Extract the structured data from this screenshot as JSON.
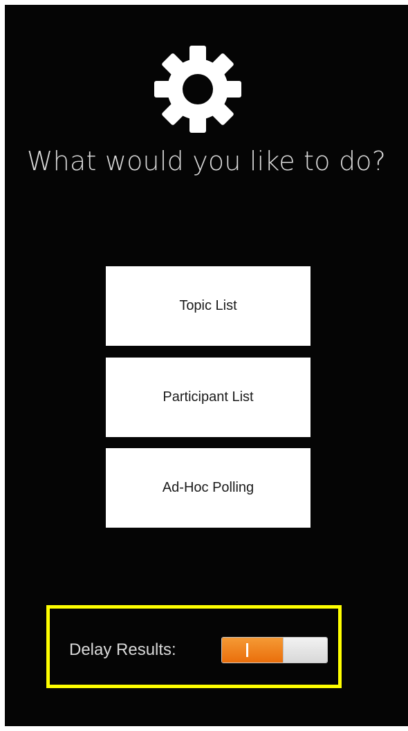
{
  "header": {
    "icon": "gear-icon",
    "title": "What would you like to do?"
  },
  "menu": {
    "buttons": [
      {
        "label": "Topic List"
      },
      {
        "label": "Participant List"
      },
      {
        "label": "Ad-Hoc Polling"
      }
    ]
  },
  "settings": {
    "delay_label": "Delay Results:",
    "delay_results_on": true,
    "toggle_on_color": "#f07f1b",
    "highlight_color": "#ffff00"
  },
  "theme": {
    "background": "#050505",
    "text": "#d9d9d9",
    "button_bg": "#ffffff"
  }
}
